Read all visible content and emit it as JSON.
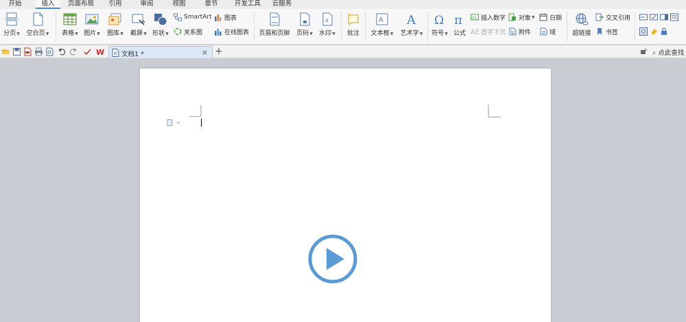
{
  "menu": {
    "tabs": [
      {
        "label": "开始",
        "active": false
      },
      {
        "label": "插入",
        "active": true
      },
      {
        "label": "页面布局",
        "active": false
      },
      {
        "label": "引用",
        "active": false
      },
      {
        "label": "审阅",
        "active": false
      },
      {
        "label": "视图",
        "active": false
      },
      {
        "label": "章节",
        "active": false
      },
      {
        "label": "开发工具",
        "active": false
      },
      {
        "label": "云服务",
        "active": false
      }
    ]
  },
  "ribbon": {
    "page_break": "分页",
    "blank_page": "空白页",
    "table": "表格",
    "picture": "图片",
    "gallery": "图库",
    "screenshot": "截屏",
    "shape": "形状",
    "smartart": "SmartArt",
    "chart": "图表",
    "relation_chart": "关系图",
    "online_chart": "在线图表",
    "header_footer": "页眉和页脚",
    "page_number": "页码",
    "watermark": "水印",
    "comment": "批注",
    "textbox": "文本框",
    "wordart": "艺术字",
    "symbol": "符号",
    "formula": "公式",
    "insert_number": "插入数字",
    "drop_cap": "首字下沉",
    "object": "对象",
    "attachment": "附件",
    "date": "日期",
    "field": "域",
    "hyperlink": "超链接",
    "cross_ref": "交叉引用",
    "bookmark": "书签"
  },
  "tabrow": {
    "doc_title": "文档1 *",
    "close": "×",
    "new_tab": "+",
    "search": "点此查找"
  },
  "colors": {
    "accent": "#4a8bd6",
    "play": "#5b9bd5"
  }
}
